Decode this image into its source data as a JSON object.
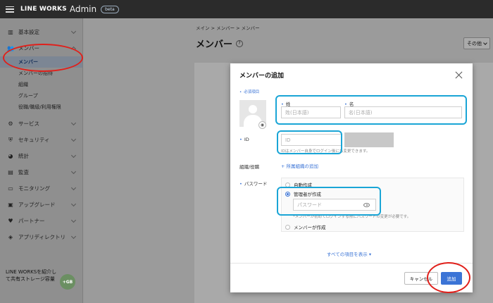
{
  "header": {
    "brand": "LINE WORKS",
    "admin": "Admin",
    "badge": "beta"
  },
  "sidebar": {
    "items": [
      {
        "label": "基本設定",
        "icon": "building-icon"
      },
      {
        "label": "メンバー",
        "icon": "users-icon"
      },
      {
        "label": "サービス",
        "icon": "gear-icon"
      },
      {
        "label": "セキュリティ",
        "icon": "shield-icon"
      },
      {
        "label": "統計",
        "icon": "pie-chart-icon"
      },
      {
        "label": "監査",
        "icon": "audit-icon"
      },
      {
        "label": "モニタリング",
        "icon": "monitor-icon"
      },
      {
        "label": "アップグレード",
        "icon": "upgrade-icon"
      },
      {
        "label": "パートナー",
        "icon": "handshake-icon"
      },
      {
        "label": "アプリディレクトリ",
        "icon": "layers-icon"
      }
    ],
    "sub_items": [
      "メンバー",
      "メンバーの招待",
      "組織",
      "グループ",
      "役職/職級/利用権限"
    ],
    "footer_line1": "LINE WORKSを紹介し",
    "footer_line2": "て共有ストレージ容量",
    "footer_badge": "+GB"
  },
  "main": {
    "breadcrumb": "メイン > メンバー > メンバー",
    "title": "メンバー",
    "help": "?",
    "other_button": "その他"
  },
  "modal": {
    "title": "メンバーの追加",
    "required_note": "必須項目",
    "last_name_label": "姓",
    "first_name_label": "名",
    "last_name_placeholder": "姓(日本語)",
    "first_name_placeholder": "名(日本語)",
    "id_label": "ID",
    "id_placeholder": "ID",
    "id_hint": "IDはメンバー自身でログイン後にも変更できます。",
    "org_label": "組織/役職",
    "org_add_link": "+ 所属組織の追加",
    "password_label": "パスワード",
    "radio_auto": "自動作成",
    "radio_admin": "管理者が作成",
    "password_placeholder": "パスワード",
    "password_hint": "*メンバーが初めてログインする際にパスワードの変更が必要です。",
    "radio_member": "メンバーが作成",
    "show_all": "すべての項目を表示",
    "cancel": "キャンセル",
    "add": "追加"
  }
}
